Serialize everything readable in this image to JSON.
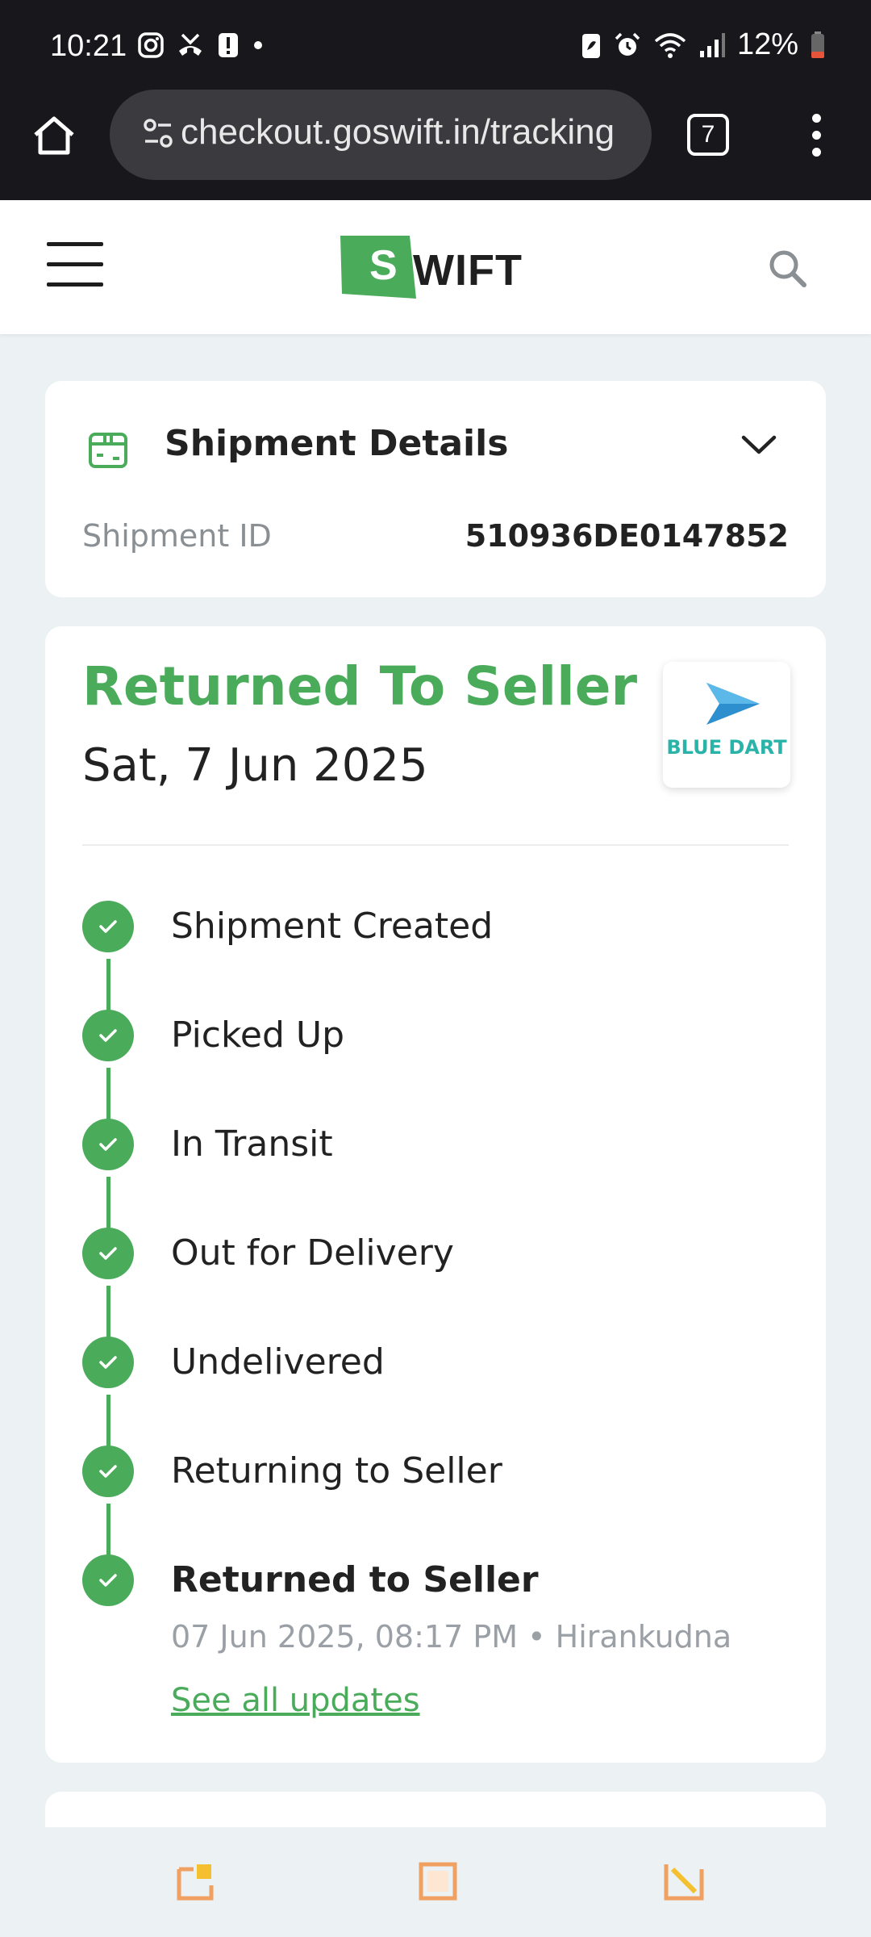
{
  "status_bar": {
    "time": "10:21",
    "battery": "12%"
  },
  "browser": {
    "url": "checkout.goswift.in/tracking",
    "tab_count": "7"
  },
  "header": {
    "logo_letter": "S",
    "logo_text": "WIFT",
    "brand_color": "#4aab5b"
  },
  "shipment_details": {
    "title": "Shipment Details",
    "id_label": "Shipment ID",
    "id_value": "510936DE0147852"
  },
  "tracking": {
    "status": "Returned To Seller",
    "date": "Sat, 7 Jun 2025",
    "courier": "BLUE DART",
    "steps": [
      {
        "label": "Shipment Created"
      },
      {
        "label": "Picked Up"
      },
      {
        "label": "In Transit"
      },
      {
        "label": "Out for Delivery"
      },
      {
        "label": "Undelivered"
      },
      {
        "label": "Returning to Seller"
      },
      {
        "label": "Returned to Seller"
      }
    ],
    "last_update": "07 Jun 2025, 08:17 PM • Hirankudna",
    "see_all": "See all updates"
  }
}
